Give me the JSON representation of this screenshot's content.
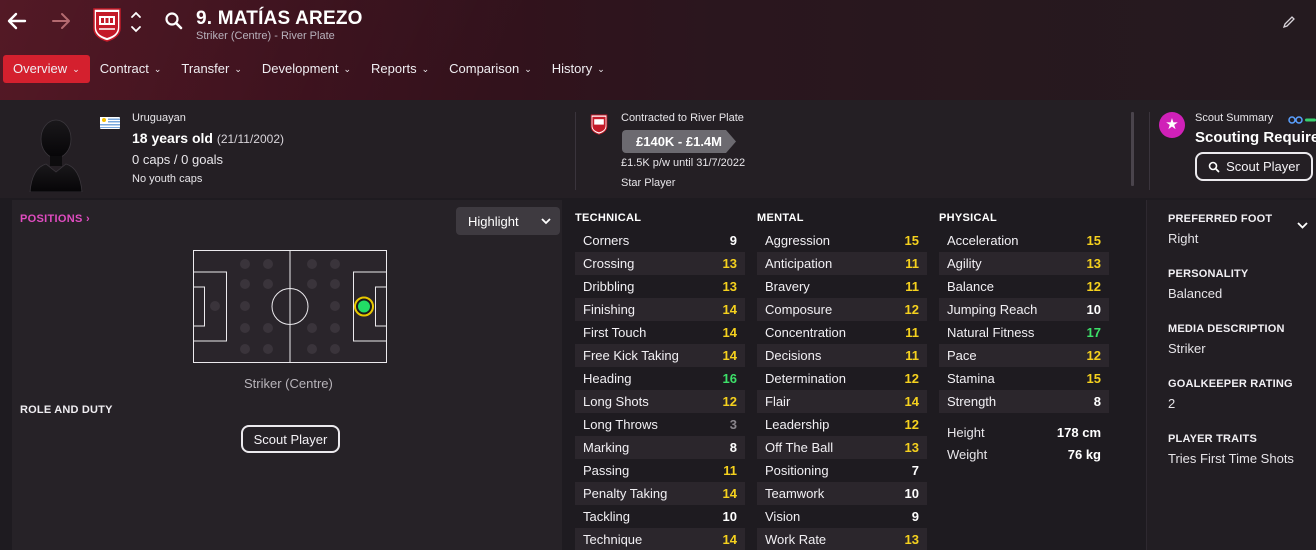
{
  "colors": {
    "accent": "#d4202e",
    "highlight_magenta": "#e04cc0",
    "attr_yellow": "#f5d11e",
    "attr_green": "#3de069",
    "attr_white": "#ffffff",
    "attr_grey": "#8a868c"
  },
  "header": {
    "player_name": "9. MATÍAS AREZO",
    "subtitle": "Striker (Centre) - River Plate",
    "icons": [
      "back-arrow-icon",
      "forward-arrow-icon",
      "club-crest-icon",
      "search-icon",
      "edit-icon"
    ]
  },
  "tabs": [
    {
      "label": "Overview",
      "active": true
    },
    {
      "label": "Contract",
      "active": false
    },
    {
      "label": "Transfer",
      "active": false
    },
    {
      "label": "Development",
      "active": false
    },
    {
      "label": "Reports",
      "active": false
    },
    {
      "label": "Comparison",
      "active": false
    },
    {
      "label": "History",
      "active": false
    }
  ],
  "info": {
    "nationality": "Uruguayan",
    "age": "18 years old",
    "dob": "(21/11/2002)",
    "caps": "0 caps / 0 goals",
    "youth_caps": "No youth caps"
  },
  "contract": {
    "status": "Contracted to River Plate",
    "value": "£140K - £1.4M",
    "wage": "£1.5K p/w until 31/7/2022",
    "role": "Star Player"
  },
  "scout": {
    "title": "Scout Summary",
    "status": "Scouting Require",
    "button": "Scout Player"
  },
  "positions": {
    "link": "POSITIONS",
    "highlight": "Highlight",
    "position_label": "Striker (Centre)",
    "role_duty": "ROLE AND DUTY",
    "scout_button": "Scout Player"
  },
  "technical": {
    "heading": "TECHNICAL",
    "rows": [
      {
        "name": "Corners",
        "value": "9"
      },
      {
        "name": "Crossing",
        "value": "13"
      },
      {
        "name": "Dribbling",
        "value": "13"
      },
      {
        "name": "Finishing",
        "value": "14"
      },
      {
        "name": "First Touch",
        "value": "14"
      },
      {
        "name": "Free Kick Taking",
        "value": "14"
      },
      {
        "name": "Heading",
        "value": "16"
      },
      {
        "name": "Long Shots",
        "value": "12"
      },
      {
        "name": "Long Throws",
        "value": "3"
      },
      {
        "name": "Marking",
        "value": "8"
      },
      {
        "name": "Passing",
        "value": "11"
      },
      {
        "name": "Penalty Taking",
        "value": "14"
      },
      {
        "name": "Tackling",
        "value": "10"
      },
      {
        "name": "Technique",
        "value": "14"
      }
    ]
  },
  "mental": {
    "heading": "MENTAL",
    "rows": [
      {
        "name": "Aggression",
        "value": "15"
      },
      {
        "name": "Anticipation",
        "value": "11"
      },
      {
        "name": "Bravery",
        "value": "11"
      },
      {
        "name": "Composure",
        "value": "12"
      },
      {
        "name": "Concentration",
        "value": "11"
      },
      {
        "name": "Decisions",
        "value": "11"
      },
      {
        "name": "Determination",
        "value": "12"
      },
      {
        "name": "Flair",
        "value": "14"
      },
      {
        "name": "Leadership",
        "value": "12"
      },
      {
        "name": "Off The Ball",
        "value": "13"
      },
      {
        "name": "Positioning",
        "value": "7"
      },
      {
        "name": "Teamwork",
        "value": "10"
      },
      {
        "name": "Vision",
        "value": "9"
      },
      {
        "name": "Work Rate",
        "value": "13"
      }
    ]
  },
  "physical": {
    "heading": "PHYSICAL",
    "rows": [
      {
        "name": "Acceleration",
        "value": "15"
      },
      {
        "name": "Agility",
        "value": "13"
      },
      {
        "name": "Balance",
        "value": "12"
      },
      {
        "name": "Jumping Reach",
        "value": "10"
      },
      {
        "name": "Natural Fitness",
        "value": "17"
      },
      {
        "name": "Pace",
        "value": "12"
      },
      {
        "name": "Stamina",
        "value": "15"
      },
      {
        "name": "Strength",
        "value": "8"
      }
    ],
    "height_label": "Height",
    "height_value": "178 cm",
    "weight_label": "Weight",
    "weight_value": "76 kg"
  },
  "side": {
    "preferred_foot_label": "PREFERRED FOOT",
    "preferred_foot": "Right",
    "personality_label": "PERSONALITY",
    "personality": "Balanced",
    "media_label": "MEDIA DESCRIPTION",
    "media": "Striker",
    "gk_label": "GOALKEEPER RATING",
    "gk": "2",
    "traits_label": "PLAYER TRAITS",
    "traits": "Tries First Time Shots"
  }
}
